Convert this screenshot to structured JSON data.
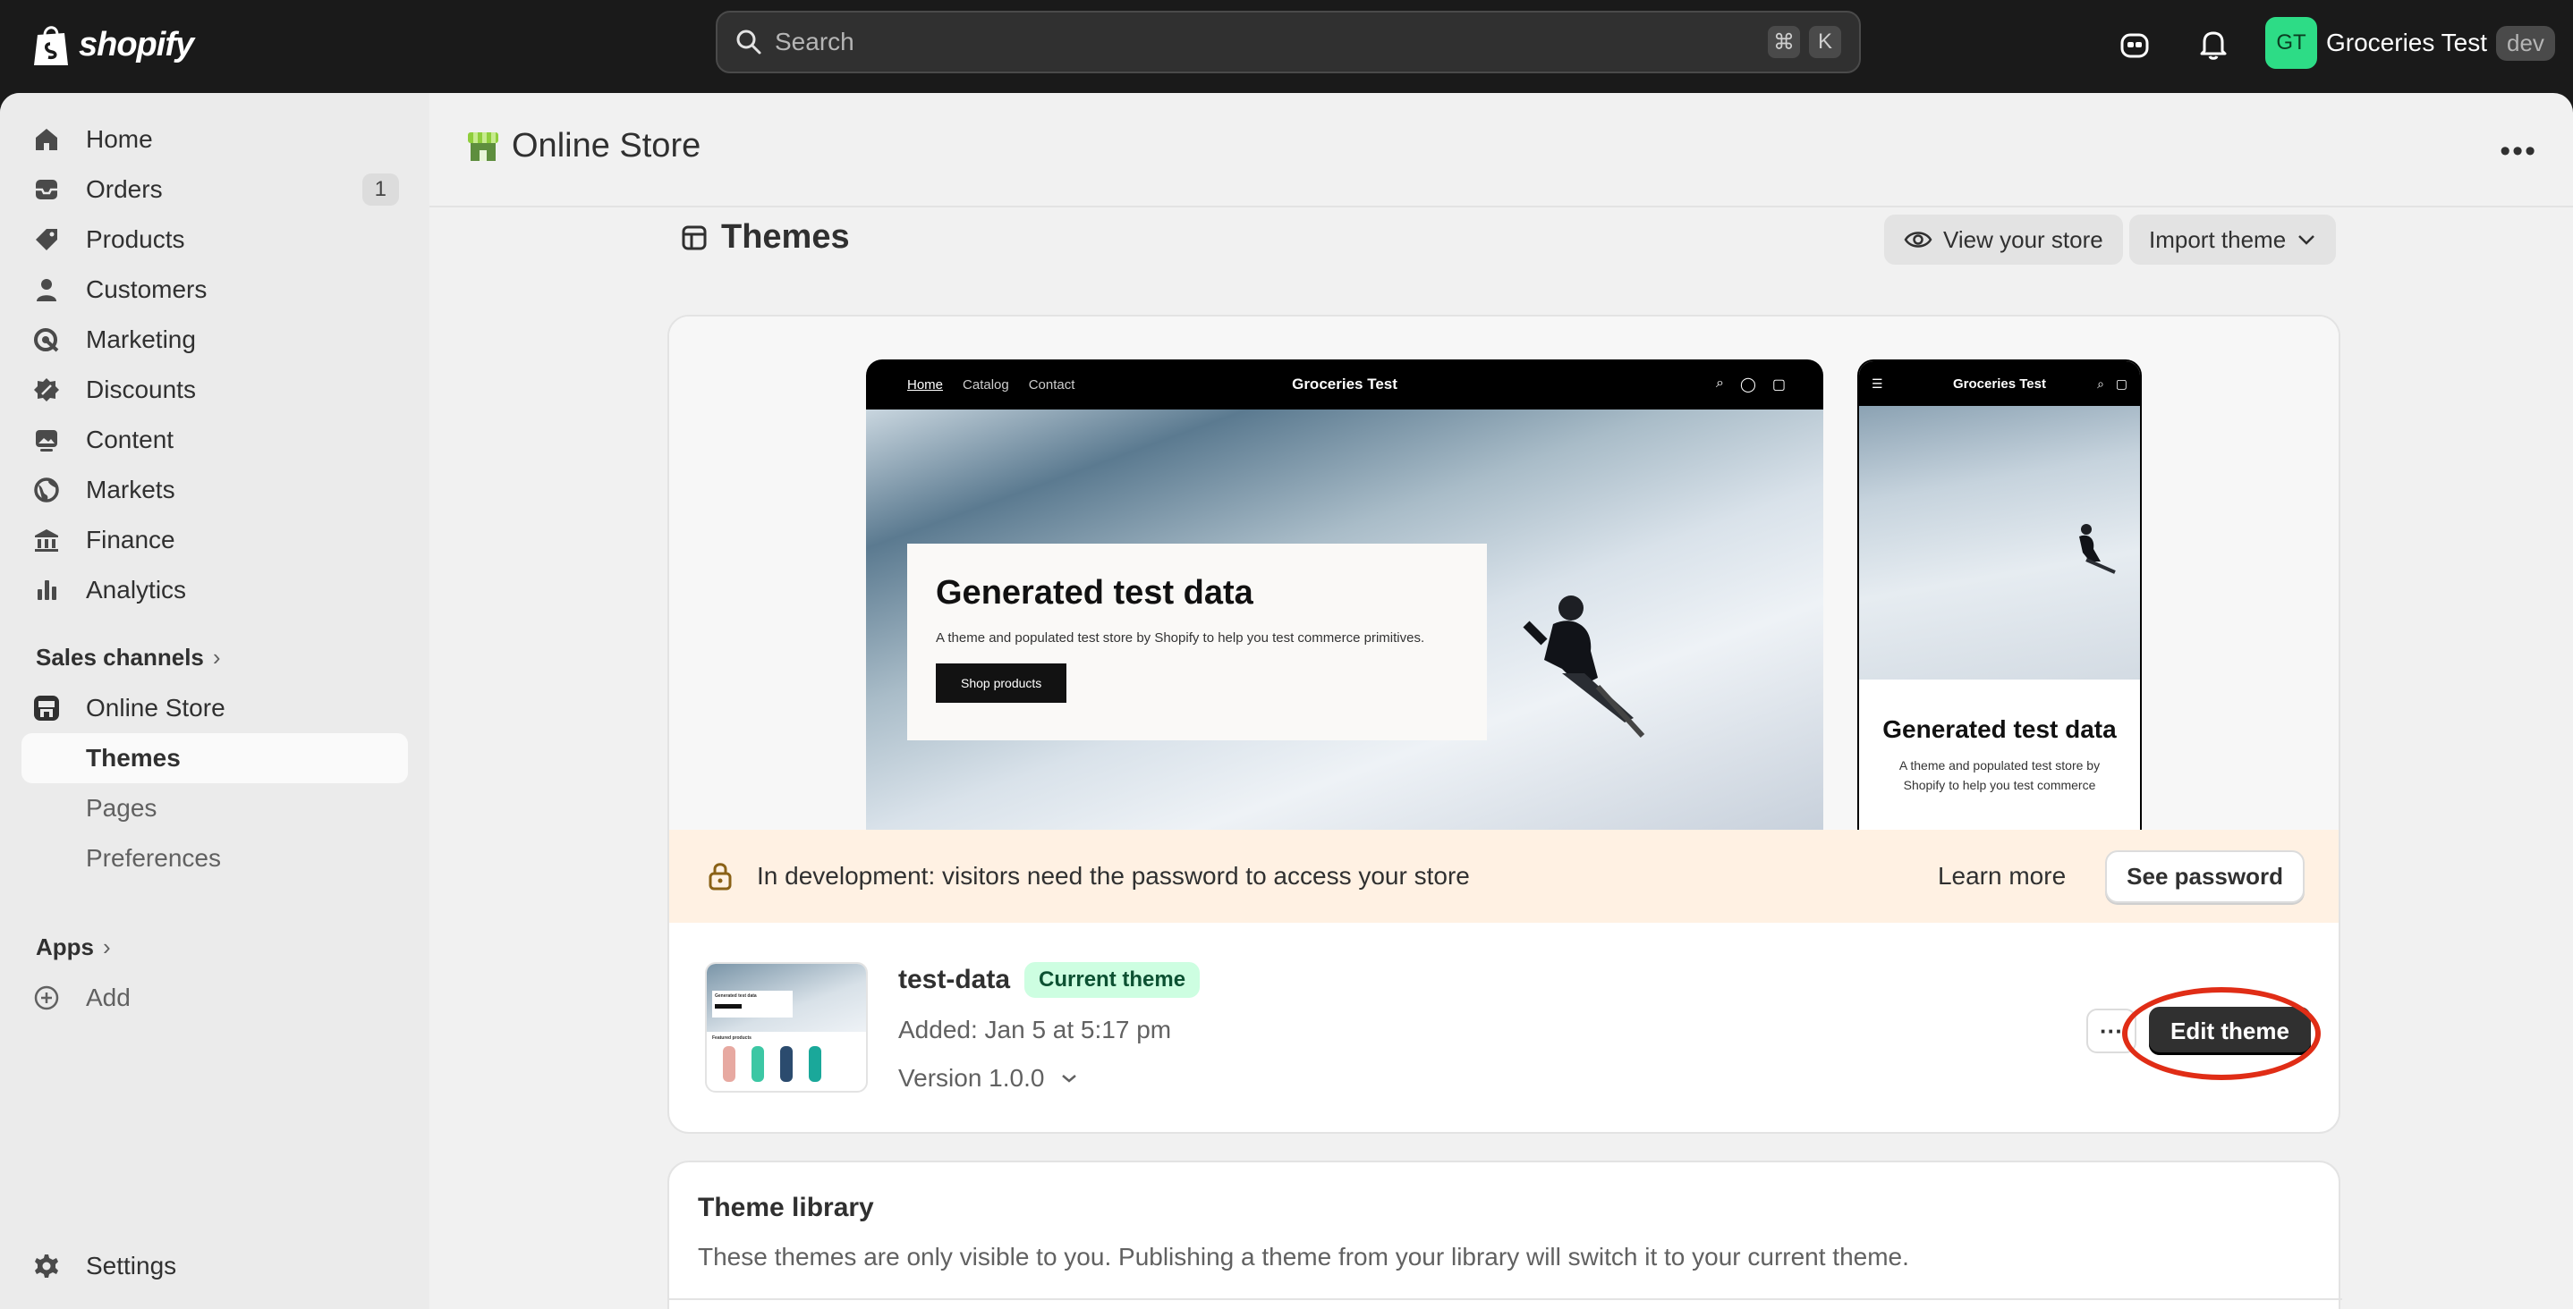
{
  "topbar": {
    "logo_text": "shopify",
    "search_placeholder": "Search",
    "shortcut_keys": [
      "⌘",
      "K"
    ],
    "account": {
      "initials": "GT",
      "name": "Groceries Test",
      "badge": "dev"
    }
  },
  "sidebar": {
    "items": [
      {
        "label": "Home",
        "icon": "home-icon"
      },
      {
        "label": "Orders",
        "icon": "orders-icon",
        "count": "1"
      },
      {
        "label": "Products",
        "icon": "tag-icon"
      },
      {
        "label": "Customers",
        "icon": "person-icon"
      },
      {
        "label": "Marketing",
        "icon": "target-icon"
      },
      {
        "label": "Discounts",
        "icon": "discount-icon"
      },
      {
        "label": "Content",
        "icon": "image-icon"
      },
      {
        "label": "Markets",
        "icon": "globe-icon"
      },
      {
        "label": "Finance",
        "icon": "bank-icon"
      },
      {
        "label": "Analytics",
        "icon": "bar-chart-icon"
      }
    ],
    "sales_channels_label": "Sales channels",
    "online_store_label": "Online Store",
    "sub_items": [
      "Themes",
      "Pages",
      "Preferences"
    ],
    "apps_label": "Apps",
    "add_label": "Add",
    "settings_label": "Settings"
  },
  "page": {
    "title": "Online Store",
    "section_title": "Themes",
    "view_store_label": "View your store",
    "import_theme_label": "Import theme"
  },
  "preview": {
    "desktop_links": [
      "Home",
      "Catalog",
      "Contact"
    ],
    "store_name": "Groceries Test",
    "hero_heading": "Generated test data",
    "hero_text": "A theme and populated test store by Shopify to help you test commerce primitives.",
    "hero_button": "Shop products",
    "mobile_heading": "Generated test data",
    "mobile_text": "A theme and populated test store by Shopify to help you test commerce"
  },
  "banner": {
    "message": "In development: visitors need the password to access your store",
    "learn_more": "Learn more",
    "see_password": "See password"
  },
  "current_theme": {
    "name": "test-data",
    "badge": "Current theme",
    "added": "Added: Jan 5 at 5:17 pm",
    "version": "Version 1.0.0",
    "edit_label": "Edit theme",
    "more_label": "···",
    "thumb_heading": "Generated test data",
    "thumb_subheading": "Featured products"
  },
  "library": {
    "title": "Theme library",
    "description": "These themes are only visible to you. Publishing a theme from your library will switch it to your current theme."
  },
  "colors": {
    "accent_green": "#2ddc86",
    "annotation_red": "#e02d16",
    "banner_bg": "#fff1e3",
    "badge_green": "#cdfee1"
  }
}
